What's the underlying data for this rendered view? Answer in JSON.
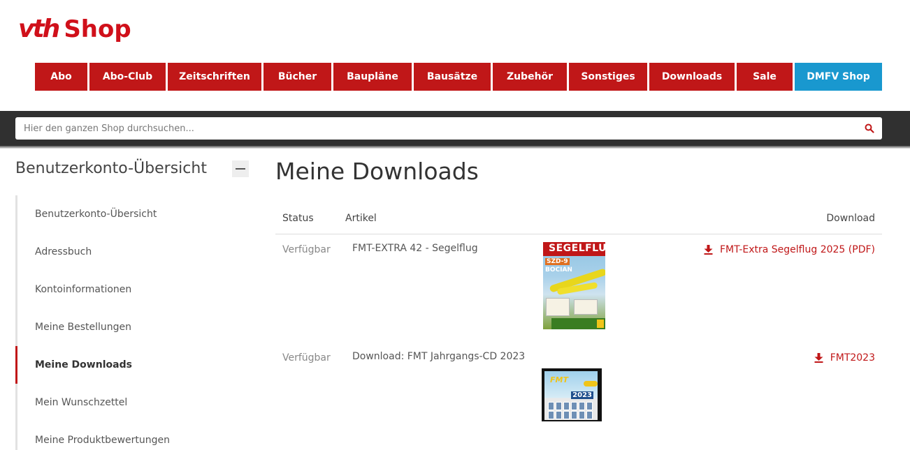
{
  "logo": {
    "brand": "vth",
    "shop": "Shop"
  },
  "nav": [
    {
      "label": "Abo",
      "color": "#c01718"
    },
    {
      "label": "Abo-Club",
      "color": "#c01718"
    },
    {
      "label": "Zeitschriften",
      "color": "#c01718"
    },
    {
      "label": "Bücher",
      "color": "#c01718"
    },
    {
      "label": "Baupläne",
      "color": "#c01718"
    },
    {
      "label": "Bausätze",
      "color": "#c01718"
    },
    {
      "label": "Zubehör",
      "color": "#c01718"
    },
    {
      "label": "Sonstiges",
      "color": "#c01718"
    },
    {
      "label": "Downloads",
      "color": "#c01718"
    },
    {
      "label": "Sale",
      "color": "#c01718"
    },
    {
      "label": "DMFV Shop",
      "color": "#1998cf"
    }
  ],
  "search": {
    "placeholder": "Hier den ganzen Shop durchsuchen...",
    "icon": "search-icon"
  },
  "sidebar": {
    "title": "Benutzerkonto-Übersicht",
    "items": [
      {
        "label": "Benutzerkonto-Übersicht",
        "active": false
      },
      {
        "label": "Adressbuch",
        "active": false
      },
      {
        "label": "Kontoinformationen",
        "active": false
      },
      {
        "label": "Meine Bestellungen",
        "active": false
      },
      {
        "label": "Meine Downloads",
        "active": true
      },
      {
        "label": "Mein Wunschzettel",
        "active": false
      },
      {
        "label": "Meine Produktbewertungen",
        "active": false
      }
    ]
  },
  "main": {
    "title": "Meine Downloads",
    "columns": {
      "status": "Status",
      "article": "Artikel",
      "download": "Download"
    },
    "rows": [
      {
        "status": "Verfügbar",
        "article": "FMT-EXTRA 42 - Segelflug",
        "download": "FMT-Extra Segelflug 2025 (PDF)",
        "thumb": {
          "masthead": "SEGELFLUG",
          "line1": "SZD-9",
          "line2": "BOCIAN"
        }
      },
      {
        "status": "Verfügbar",
        "article": "Download: FMT Jahrgangs-CD 2023",
        "download": "FMT2023",
        "thumb": {
          "logo": "FMT",
          "year": "2023"
        }
      }
    ]
  },
  "colors": {
    "brand_red": "#c01718",
    "dmfv_blue": "#1998cf",
    "search_band": "#303030"
  }
}
